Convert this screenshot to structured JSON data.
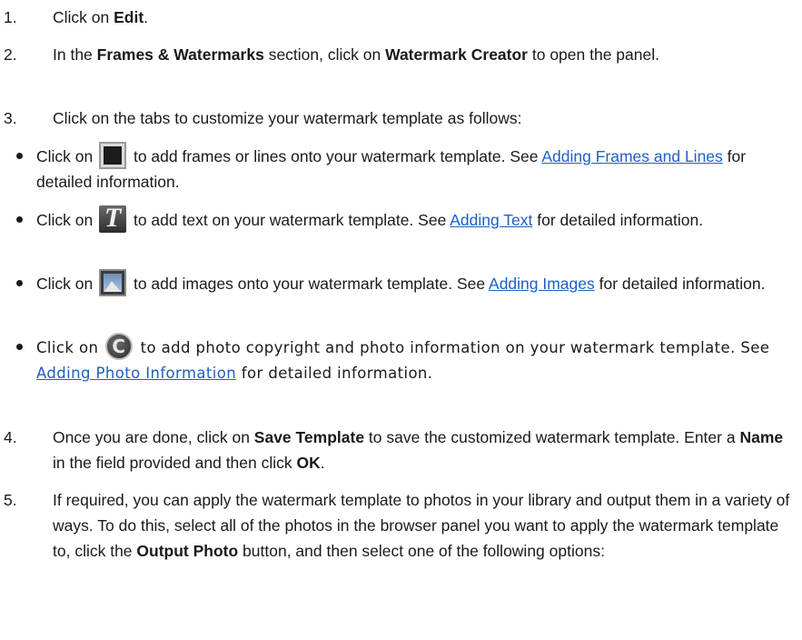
{
  "steps": [
    {
      "num": "1.",
      "pre": "Click on ",
      "b1": "Edit",
      "post": "."
    },
    {
      "num": "2.",
      "pre": "In the ",
      "b1": "Frames & Watermarks",
      "mid": " section, click on ",
      "b2": "Watermark Creator",
      "post": " to open the panel."
    },
    {
      "num": "3.",
      "text": "Click on the tabs to customize your watermark template as follows:"
    },
    {
      "num": "4.",
      "pre": "Once you are done, click on ",
      "b1": "Save Template",
      "mid": " to save the customized watermark template. Enter a ",
      "b2": "Name",
      "mid2": " in the field provided and then click ",
      "b3": "OK",
      "post": "."
    },
    {
      "num": "5.",
      "pre": "If required, you can apply the watermark template to photos in your library and output them in a variety of ways. To do this, select all of the photos in the browser panel you want to apply the watermark template to, click the ",
      "b1": "Output Photo",
      "post": " button, and then select one of the following options:"
    }
  ],
  "bullets": [
    {
      "icon": "frame-icon",
      "pre": "Click on ",
      "post": " to add frames or lines onto your watermark template. See ",
      "link": "Adding Frames and Lines",
      "tail": " for detailed information."
    },
    {
      "icon": "text-icon",
      "glyph": "T",
      "pre": "Click on ",
      "post": " to add text on your watermark template. See ",
      "link": "Adding Text",
      "tail": " for detailed information."
    },
    {
      "icon": "image-icon",
      "pre": "Click on ",
      "post": " to add images onto your watermark template. See ",
      "link": "Adding Images",
      "tail": " for detailed information."
    },
    {
      "icon": "copyright-icon",
      "glyph": "C",
      "pre": "Click on ",
      "post": " to add photo copyright and photo information on your watermark template. See ",
      "link": "Adding Photo Information",
      "tail": " for detailed information."
    }
  ],
  "colors": {
    "link": "#1f5fc4",
    "text": "#1a1a1a"
  }
}
